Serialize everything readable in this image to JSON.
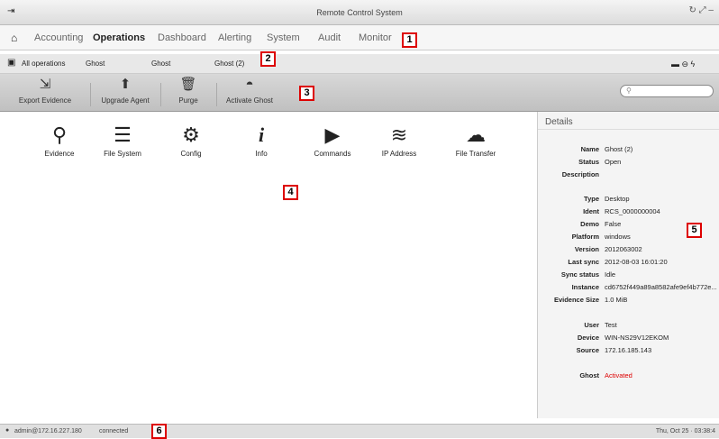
{
  "title": "Remote Control System",
  "menu": [
    "Accounting",
    "Operations",
    "Dashboard",
    "Alerting",
    "System",
    "Audit",
    "Monitor"
  ],
  "crumb": [
    "All operations",
    "Ghost",
    "Ghost",
    "Ghost (2)"
  ],
  "tools": [
    {
      "label": "Export Evidence",
      "icon": "export-icon"
    },
    {
      "label": "Upgrade Agent",
      "icon": "upgrade-icon"
    },
    {
      "label": "Purge",
      "icon": "trash-icon"
    },
    {
      "label": "Activate Ghost",
      "icon": "ghost-icon"
    }
  ],
  "modules": [
    "Evidence",
    "File System",
    "Config",
    "Info",
    "Commands",
    "IP Address",
    "File Transfer"
  ],
  "details": {
    "header": "Details",
    "rows": [
      [
        "Name",
        "Ghost (2)"
      ],
      [
        "Status",
        "Open"
      ],
      [
        "Description",
        ""
      ],
      [
        "Type",
        "Desktop"
      ],
      [
        "Ident",
        "RCS_0000000004"
      ],
      [
        "Demo",
        "False"
      ],
      [
        "Platform",
        "windows"
      ],
      [
        "Version",
        "2012063002"
      ],
      [
        "Last sync",
        "2012-08-03 16:01:20"
      ],
      [
        "Sync status",
        "Idle"
      ],
      [
        "Instance",
        "cd6752f449a89a8582afe9ef4b772e..."
      ],
      [
        "Evidence Size",
        "1.0 MiB"
      ],
      [
        "User",
        "Test"
      ],
      [
        "Device",
        "WIN-NS29V12EKOM"
      ],
      [
        "Source",
        "172.16.185.143"
      ],
      [
        "Ghost",
        "Activated"
      ]
    ]
  },
  "status": {
    "user": "admin@172.16.227.180",
    "conn": "connected",
    "time": "Thu, Oct 25 · 03:38:4"
  },
  "callouts": [
    "1",
    "2",
    "3",
    "4",
    "5",
    "6"
  ]
}
